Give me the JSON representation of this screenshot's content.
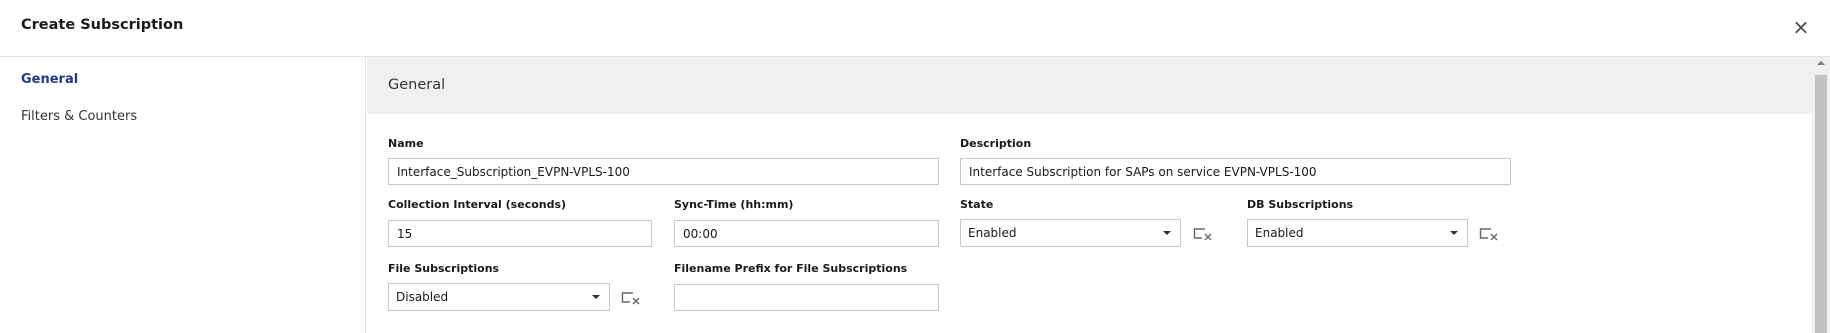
{
  "dialog": {
    "title": "Create Subscription",
    "close_glyph": "×"
  },
  "sidebar": {
    "items": [
      {
        "label": "General",
        "active": true
      },
      {
        "label": "Filters & Counters",
        "active": false
      }
    ]
  },
  "section": {
    "title": "General"
  },
  "form": {
    "name": {
      "label": "Name",
      "value": "Interface_Subscription_EVPN-VPLS-100"
    },
    "description": {
      "label": "Description",
      "value": "Interface Subscription for SAPs on service EVPN-VPLS-100"
    },
    "collection_interval": {
      "label": "Collection Interval (seconds)",
      "value": "15"
    },
    "sync_time": {
      "label": "Sync-Time (hh:mm)",
      "value": "00:00"
    },
    "state": {
      "label": "State",
      "value": "Enabled",
      "clear_icon": "clear-selection-icon"
    },
    "db_subscriptions": {
      "label": "DB Subscriptions",
      "value": "Enabled",
      "clear_icon": "clear-selection-icon"
    },
    "file_subscriptions": {
      "label": "File Subscriptions",
      "value": "Disabled",
      "clear_icon": "clear-selection-icon"
    },
    "filename_prefix": {
      "label": "Filename Prefix for File Subscriptions",
      "value": ""
    }
  },
  "colors": {
    "accent": "#1e3a8a",
    "header_bg": "#f0f0f0",
    "border": "#c8c8c8"
  }
}
